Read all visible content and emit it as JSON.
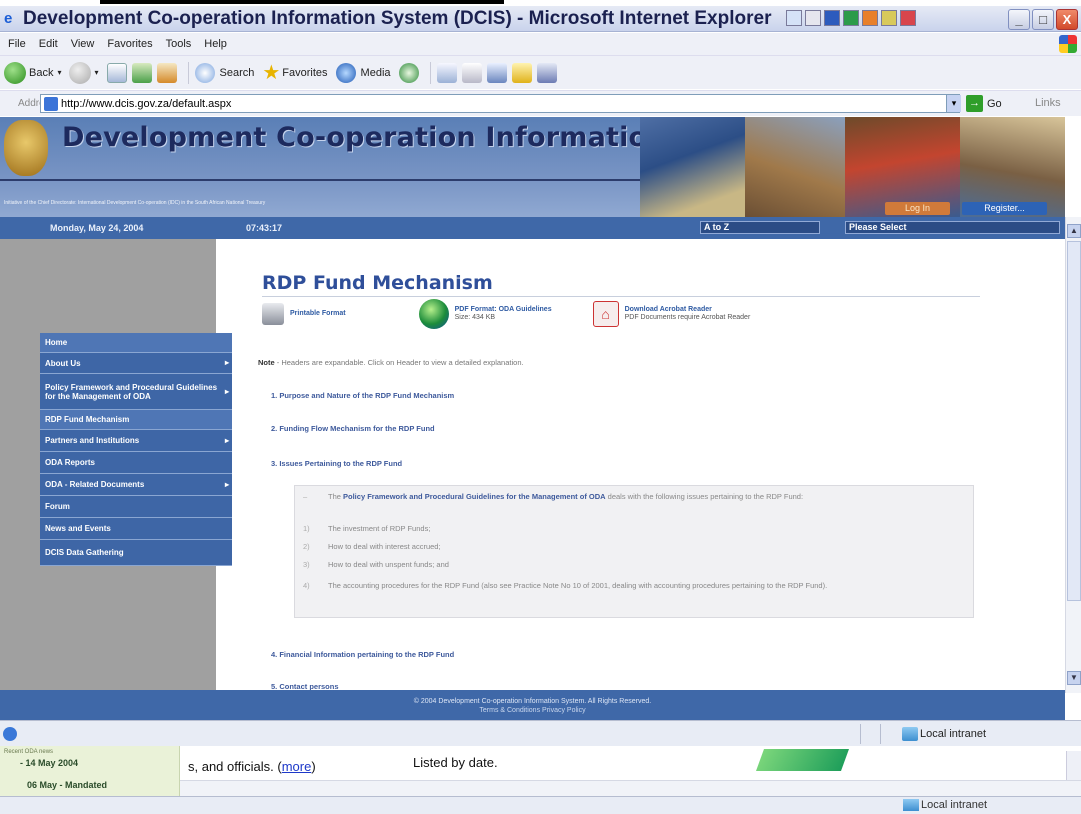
{
  "window": {
    "title": "Development Co-operation Information System (DCIS) - Microsoft Internet Explorer",
    "controls": [
      "_",
      "□",
      "X"
    ]
  },
  "menubar": [
    "File",
    "Edit",
    "View",
    "Favorites",
    "Tools",
    "Help"
  ],
  "toolbar": {
    "back": "Back",
    "search": "Search",
    "favorites": "Favorites",
    "media": "Media"
  },
  "address": {
    "label": "Address",
    "url": "http://www.dcis.gov.za/default.aspx",
    "go": "Go",
    "links": "Links"
  },
  "site": {
    "title": "Development Co-operation Information System",
    "subtitle": "Initiative of the Chief Directorate: International Development Co-operation (IDC) in the South African National Treasury",
    "login": "Log In",
    "register": "Register..."
  },
  "navstrip": {
    "date": "Monday, May 24, 2004",
    "time": "07:43:17",
    "az": "A to Z",
    "please_select": "Please Select"
  },
  "sidebar": {
    "items": [
      {
        "label": "Home",
        "arrow": false
      },
      {
        "label": "About Us",
        "arrow": true
      },
      {
        "label": "Policy Framework and Procedural Guidelines for the Management of ODA",
        "arrow": true
      },
      {
        "label": "RDP Fund Mechanism",
        "arrow": false
      },
      {
        "label": "Partners and Institutions",
        "arrow": true
      },
      {
        "label": "ODA Reports",
        "arrow": false
      },
      {
        "label": "ODA - Related Documents",
        "arrow": true
      },
      {
        "label": "Forum",
        "arrow": false
      },
      {
        "label": "News and Events",
        "arrow": false
      },
      {
        "label": "DCIS Data Gathering",
        "arrow": false
      }
    ]
  },
  "content": {
    "title": "RDP Fund Mechanism",
    "tools": {
      "printable": "Printable Format",
      "pdf_title": "PDF Format: ODA Guidelines",
      "pdf_size": "Size: 434 KB",
      "acrobat_title": "Download Acrobat Reader",
      "acrobat_sub": "PDF Documents require Acrobat Reader"
    },
    "note_label": "Note",
    "note_text": " - Headers are expandable. Click on Header to view a detailed explanation.",
    "sections": [
      "1. Purpose and Nature of the RDP Fund Mechanism",
      "2. Funding Flow Mechanism for the RDP Fund",
      "3. Issues Pertaining to the RDP Fund",
      "4. Financial Information pertaining to the RDP Fund",
      "5. Contact persons"
    ],
    "box": {
      "intro_dash": "–",
      "intro_pre": "The ",
      "intro_link": "Policy Framework and Procedural Guidelines for the Management of ODA",
      "intro_post": " deals with the following issues pertaining to the RDP Fund:",
      "items": [
        {
          "num": "1)",
          "text": "The investment of RDP Funds;"
        },
        {
          "num": "2)",
          "text": "How to deal with interest accrued;"
        },
        {
          "num": "3)",
          "text": "How to deal with unspent funds; and"
        },
        {
          "num": "4)",
          "text": "The accounting procedures for the RDP Fund (also see Practice Note No 10 of 2001, dealing with accounting procedures pertaining to the RDP Fund)."
        }
      ]
    }
  },
  "footer": {
    "copyright": "© 2004 Development Co-operation Information System. All Rights Reserved.",
    "links": "Terms & Conditions  Privacy Policy"
  },
  "statusbar": {
    "zone": "Local intranet"
  },
  "background_window": {
    "news_header": "Recent ODA news",
    "news_item1": "- 14 May 2004",
    "news_item2": "06 May - Mandated",
    "text_pre": "s, and officials. (",
    "text_more": "more",
    "text_post": ")",
    "text_listed": "Listed by date.",
    "zone": "Local intranet"
  }
}
